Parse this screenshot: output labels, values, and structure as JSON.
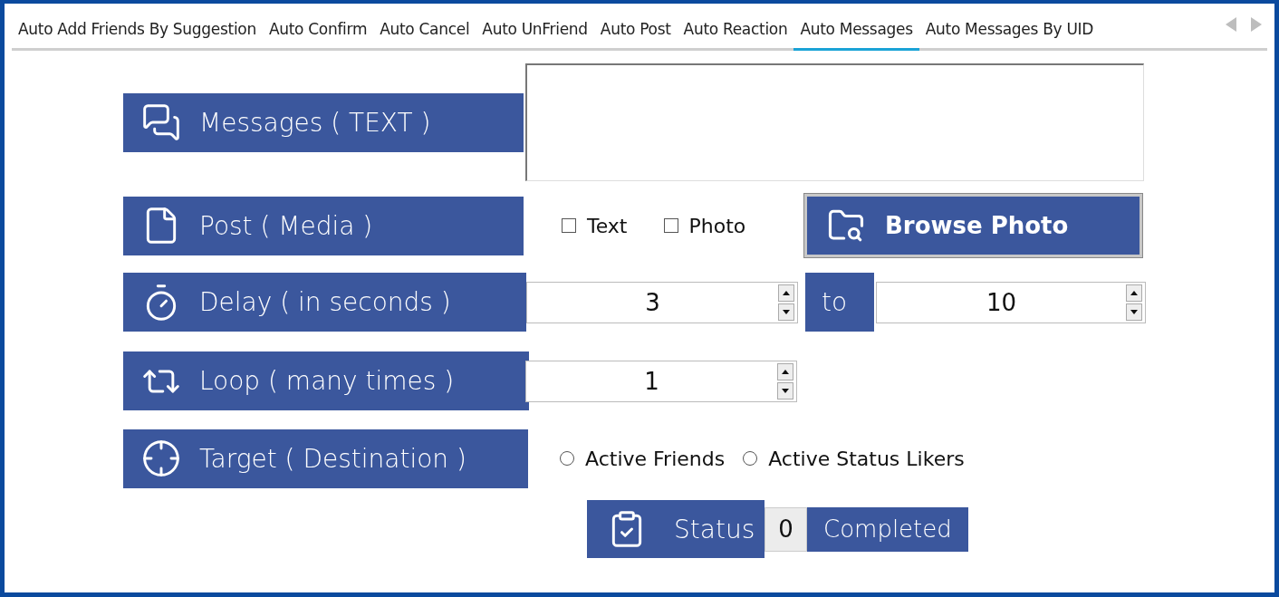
{
  "tabs": [
    {
      "label": "Auto Add Friends By Suggestion",
      "selected": false
    },
    {
      "label": "Auto Confirm",
      "selected": false
    },
    {
      "label": "Auto Cancel",
      "selected": false
    },
    {
      "label": "Auto UnFriend",
      "selected": false
    },
    {
      "label": "Auto Post",
      "selected": false
    },
    {
      "label": "Auto Reaction",
      "selected": false
    },
    {
      "label": "Auto Messages",
      "selected": true
    },
    {
      "label": "Auto Messages By UID",
      "selected": false
    }
  ],
  "messages": {
    "label": "Messages ( TEXT )"
  },
  "post_media": {
    "label": "Post ( Media )",
    "options": [
      {
        "label": "Text",
        "checked": false
      },
      {
        "label": "Photo",
        "checked": false
      }
    ],
    "browse_button": "Browse Photo"
  },
  "delay": {
    "label": "Delay ( in seconds )",
    "from": "3",
    "separator": "to",
    "to": "10"
  },
  "loop": {
    "label": "Loop ( many times )",
    "value": "1"
  },
  "target": {
    "label": "Target ( Destination )",
    "options": [
      {
        "label": "Active Friends",
        "selected": false
      },
      {
        "label": "Active Status Likers",
        "selected": false
      }
    ]
  },
  "status": {
    "label": "Status",
    "count": "0",
    "text": "Completed"
  }
}
